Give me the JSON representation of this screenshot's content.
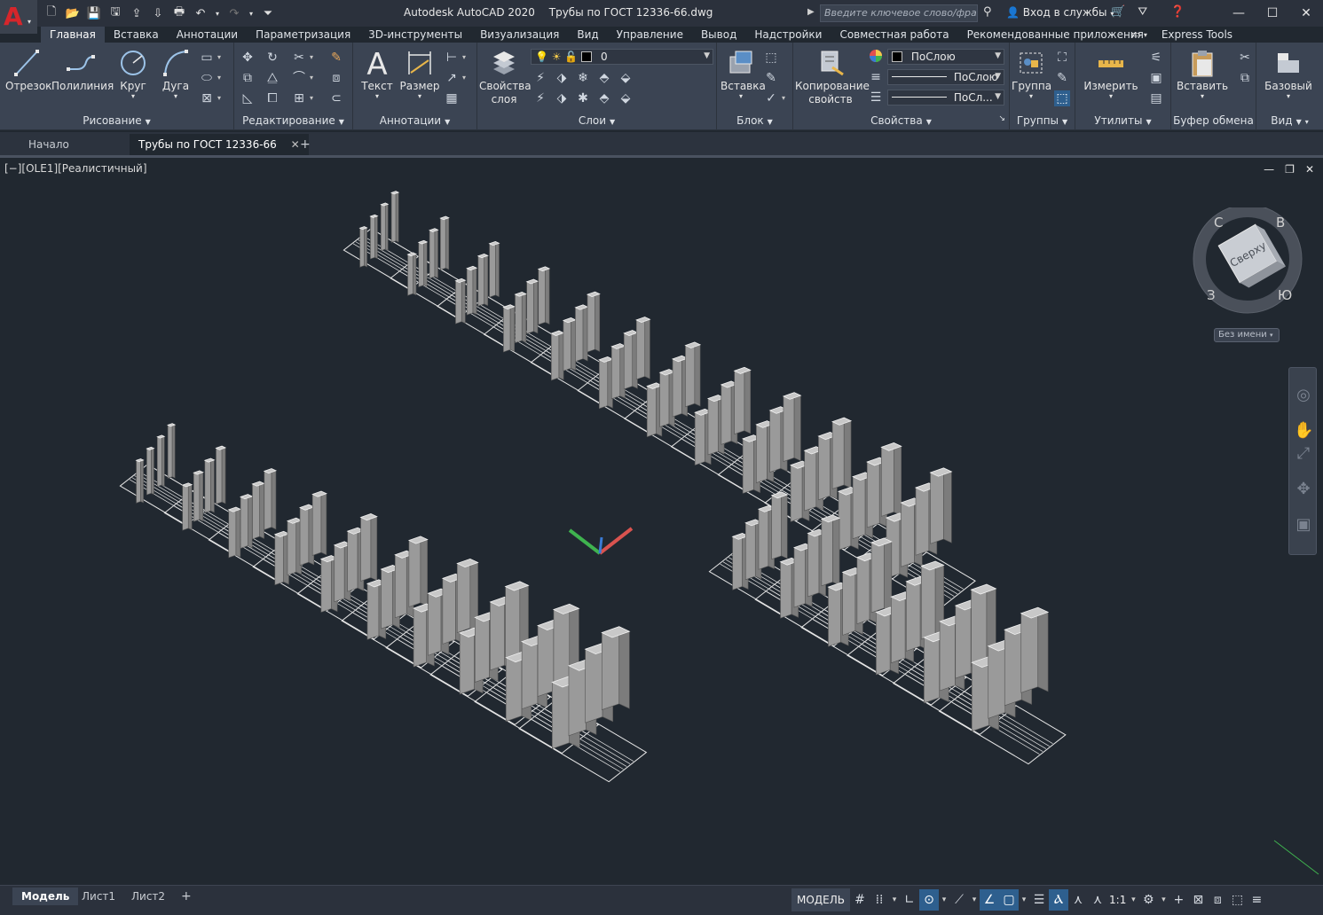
{
  "window": {
    "app_name": "Autodesk AutoCAD 2020",
    "file_name": "Трубы по ГОСТ 12336-66.dwg",
    "search_placeholder": "Введите ключевое слово/фразу",
    "signin_label": "Вход в службы"
  },
  "ribbon_tabs": [
    "Главная",
    "Вставка",
    "Аннотации",
    "Параметризация",
    "3D-инструменты",
    "Визуализация",
    "Вид",
    "Управление",
    "Вывод",
    "Надстройки",
    "Совместная работа",
    "Рекомендованные приложения",
    "Express Tools"
  ],
  "active_tab": "Главная",
  "panels": {
    "draw": {
      "title": "Рисование",
      "line": "Отрезок",
      "polyline": "Полилиния",
      "circle": "Круг",
      "arc": "Дуга"
    },
    "modify": {
      "title": "Редактирование"
    },
    "annotation": {
      "title": "Аннотации",
      "text": "Текст",
      "dimension": "Размер"
    },
    "layers": {
      "title": "Слои",
      "properties_line1": "Свойства",
      "properties_line2": "слоя",
      "current_layer": "0"
    },
    "block": {
      "title": "Блок",
      "insert": "Вставка"
    },
    "properties": {
      "title": "Свойства",
      "match_line1": "Копирование",
      "match_line2": "свойств",
      "color": "ПоСлою",
      "linetype": "ПоСлою",
      "lineweight": "ПоСл..."
    },
    "groups": {
      "title": "Группы",
      "group": "Группа"
    },
    "utilities": {
      "title": "Утилиты",
      "measure": "Измерить"
    },
    "clipboard": {
      "title": "Буфер обмена",
      "paste": "Вставить"
    },
    "view": {
      "title": "Вид",
      "base": "Базовый"
    }
  },
  "doc_tabs": {
    "start": "Начало",
    "current": "Трубы по ГОСТ 12336-66"
  },
  "viewport": {
    "label": "[−][OLE1][Реалистичный]",
    "viewcube_face": "Сверху",
    "compass": {
      "north": "С",
      "east": "В",
      "south": "Ю",
      "west": "З"
    },
    "ucs_name": "Без имени"
  },
  "layout_tabs": [
    "Модель",
    "Лист1",
    "Лист2"
  ],
  "status": {
    "space": "МОДЕЛЬ",
    "scale": "1:1"
  },
  "colors": {
    "background": "#212830",
    "ribbon": "#3b4453",
    "titlebar": "#2b313c",
    "axis_x": "#d9534f",
    "axis_y": "#3fb34f",
    "axis_z": "#3a7bd5"
  }
}
